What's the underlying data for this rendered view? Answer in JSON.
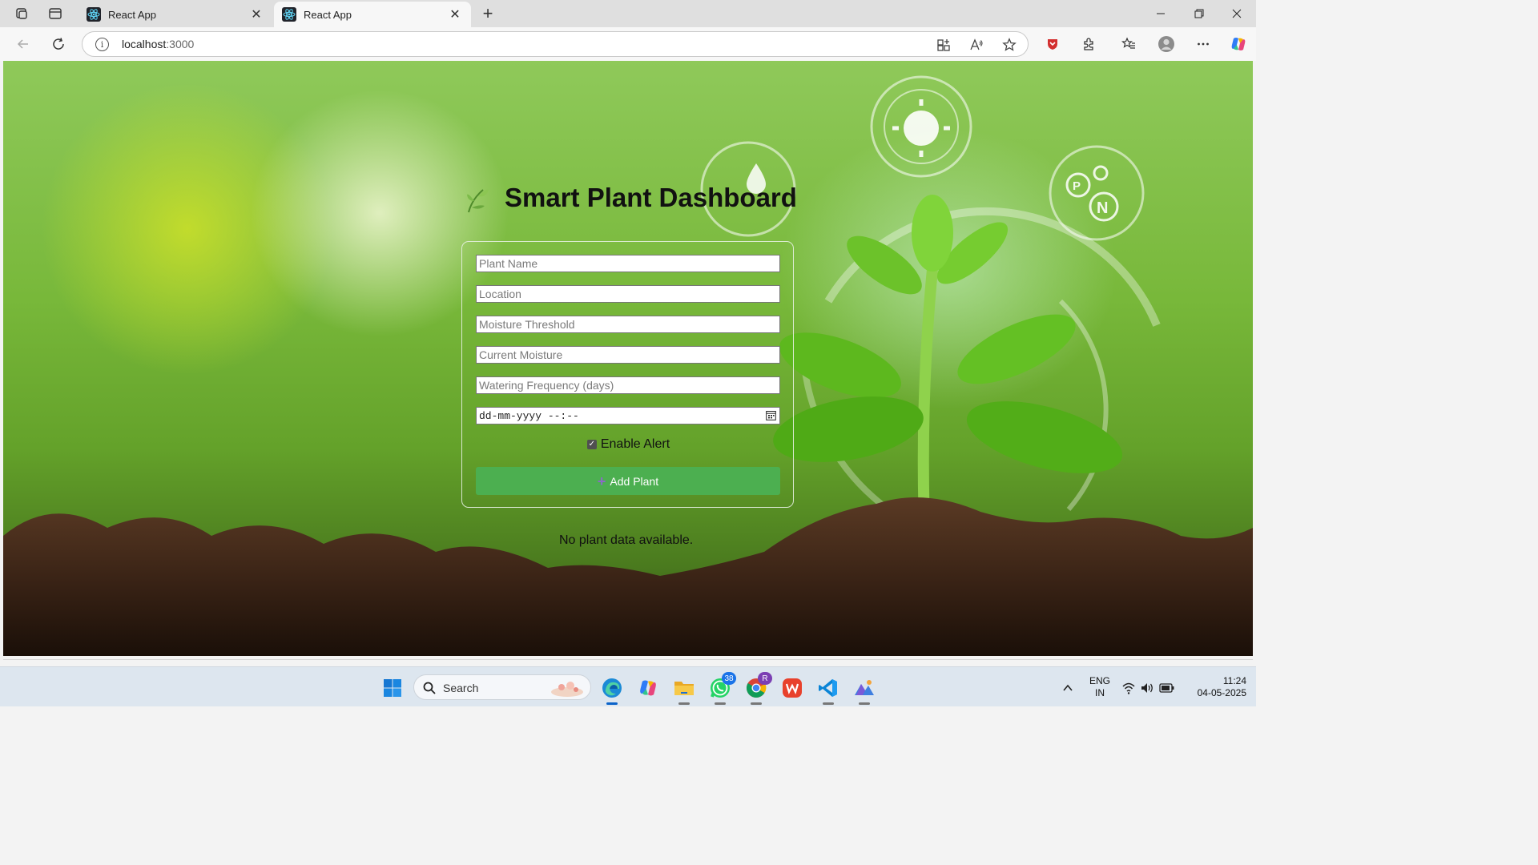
{
  "browser": {
    "tabs": [
      {
        "title": "React App",
        "active": false
      },
      {
        "title": "React App",
        "active": true
      }
    ],
    "address": {
      "host": "localhost",
      "port": ":3000"
    }
  },
  "page": {
    "title": "Smart Plant Dashboard",
    "form": {
      "plant_name_placeholder": "Plant Name",
      "location_placeholder": "Location",
      "moisture_threshold_placeholder": "Moisture Threshold",
      "current_moisture_placeholder": "Current Moisture",
      "watering_frequency_placeholder": "Watering Frequency (days)",
      "datetime_value": "dd-mm-yyyy --:--",
      "enable_alert_label": "Enable Alert",
      "enable_alert_checked": true,
      "add_button_label": "Add Plant"
    },
    "empty_message": "No plant data available."
  },
  "taskbar": {
    "search_label": "Search",
    "whatsapp_badge": "38",
    "chrome_profile_initial": "R",
    "language": "ENG",
    "region": "IN",
    "time": "11:24",
    "date": "04-05-2025"
  },
  "colors": {
    "add_button": "#4caf50",
    "tab_strip": "#dfdfdf",
    "taskbar": "#dde6ef"
  }
}
